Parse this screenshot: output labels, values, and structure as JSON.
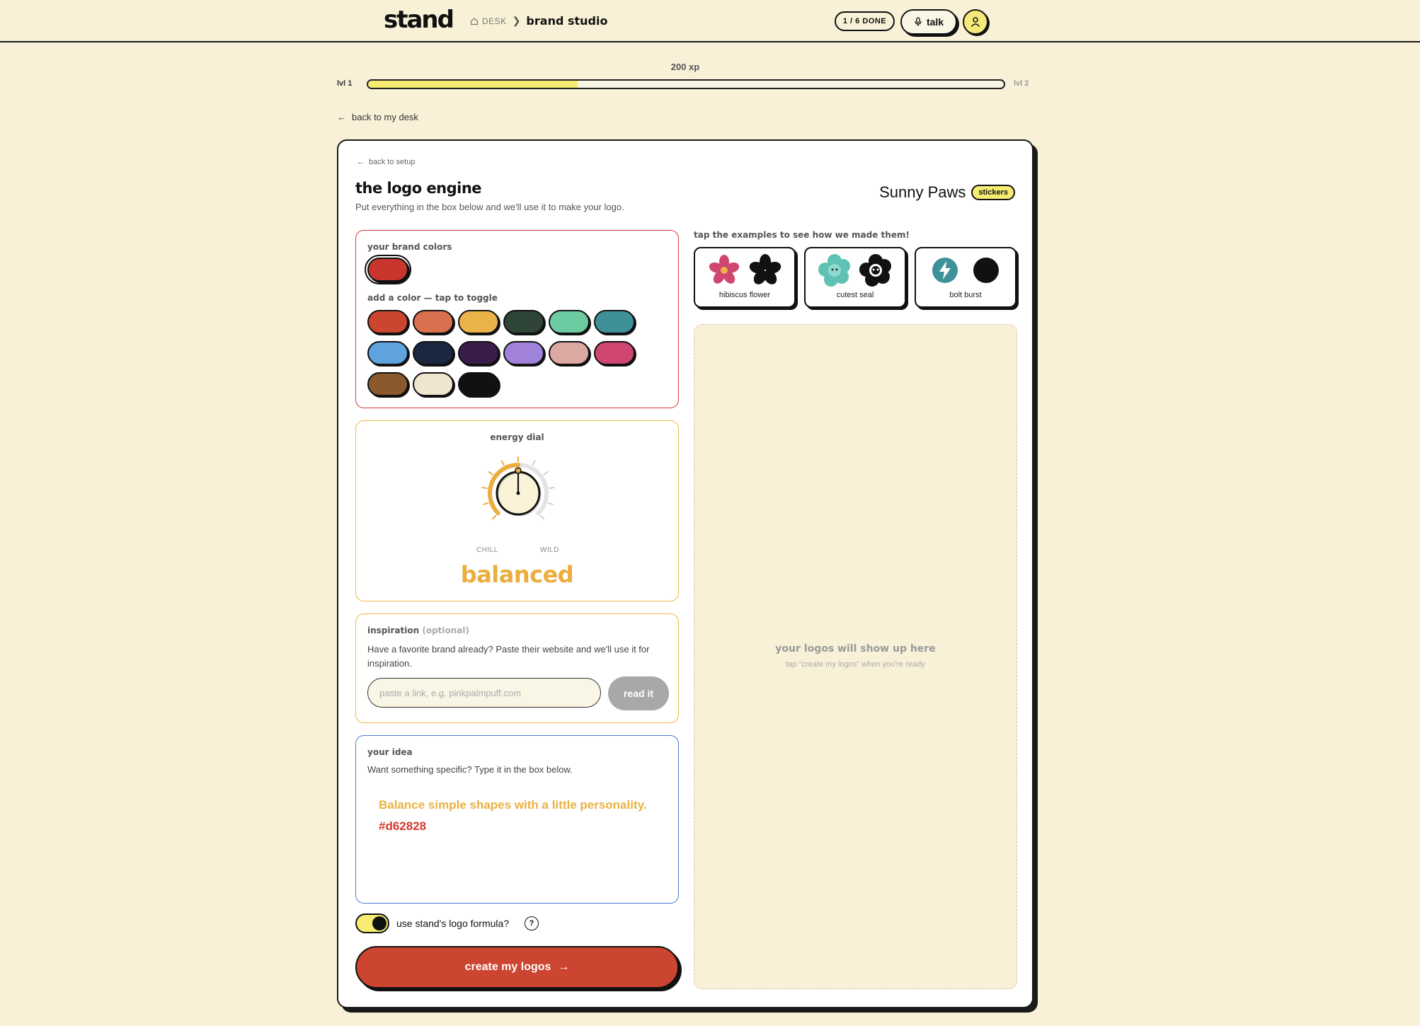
{
  "app": {
    "brand": "stand",
    "breadcrumb_home": "DESK",
    "breadcrumb_current": "brand studio",
    "progress_pill": "1 / 6 DONE",
    "talk_label": "talk"
  },
  "xp": {
    "label": "200 xp",
    "level_from": "lvl 1",
    "level_to": "lvl 2",
    "progress_fraction": 0.33
  },
  "nav": {
    "back_desk": "back to my desk",
    "back_setup": "back to setup"
  },
  "engine": {
    "title": "the logo engine",
    "subtitle": "Put everything in the box below and we'll use it to make your logo.",
    "business_name": "Sunny Paws",
    "business_tag": "stickers"
  },
  "colors": {
    "label": "your brand colors",
    "add_label": "add a color — tap to toggle",
    "selected": [
      "#c8362e"
    ],
    "palette": [
      "#cc4530",
      "#d9704e",
      "#ebb24a",
      "#2e4538",
      "#6ccba0",
      "#3f9199",
      "#5ea2de",
      "#1b2740",
      "#3a1d4a",
      "#a082da",
      "#dca8a2",
      "#cf4671",
      "#8a5a2e",
      "#efe5d0",
      "#111111"
    ]
  },
  "dial": {
    "label": "energy dial",
    "min_label": "CHILL",
    "max_label": "WILD",
    "value": "balanced",
    "level_fraction": 0.5,
    "accent": "#ebae3e"
  },
  "inspiration": {
    "label": "inspiration",
    "label_optional": "(optional)",
    "text": "Have a favorite brand already? Paste their website and we'll use it for inspiration.",
    "placeholder": "paste a link, e.g. pinkpalmpuff.com",
    "button": "read it"
  },
  "idea": {
    "label": "your idea",
    "subtitle": "Want something specific? Type it in the box below.",
    "line1": "Balance simple shapes with a little personality.",
    "line2": "#d62828"
  },
  "formula": {
    "label": "use stand's logo formula?",
    "help": "?",
    "enabled": true
  },
  "create_button": "create my logos",
  "examples": {
    "title": "tap the examples to see how we made them!",
    "items": [
      {
        "label": "hibiscus flower",
        "icons": [
          "pink-flower-icon",
          "black-flower-icon"
        ]
      },
      {
        "label": "cutest seal",
        "icons": [
          "teal-seal-icon",
          "black-seal-icon"
        ]
      },
      {
        "label": "bolt burst",
        "icons": [
          "teal-bolt-icon",
          "black-circle-icon"
        ]
      }
    ]
  },
  "results": {
    "title": "your logos will show up here",
    "subtitle": "tap \"create my logos\" when you're ready"
  }
}
